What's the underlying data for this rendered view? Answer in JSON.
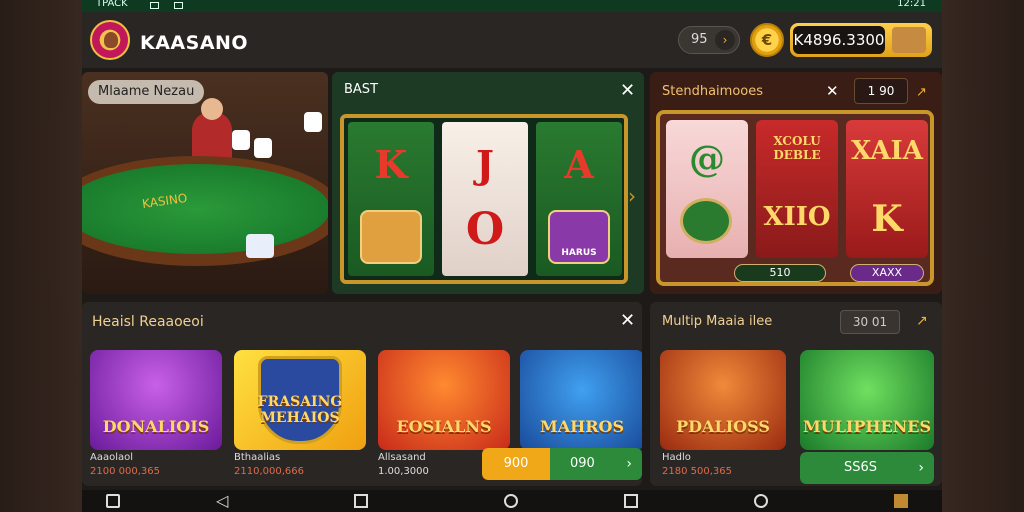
{
  "statusbar": {
    "left": "TPACK",
    "right": "12:21"
  },
  "header": {
    "brand": "KAASANO",
    "pill_value": "95",
    "coin_symbol": "€",
    "balance": "K4896.3300"
  },
  "live_table": {
    "tag": "Mlaame Nezau",
    "felt_text": "KASINO"
  },
  "slots_a": {
    "title": "BAST",
    "reel1_top": "K",
    "reel2_top": "J",
    "reel2_mid": "O",
    "reel3_top": "A",
    "badge_label": "HARUS"
  },
  "slots_b": {
    "title": "Stendhaimooes",
    "mini_value": "1 90",
    "reel1_top": "@",
    "reel2_top": "XCOLU DEBLE",
    "reel2_mid": "XIIO",
    "reel3_top": "XAIA",
    "reel3_mid": "K",
    "bar_left": "510",
    "bar_right": "XAXX"
  },
  "recent": {
    "title": "Heaisl Reaaoeoi",
    "games": [
      {
        "name": "DONALIOIS",
        "meta1": "Aaaolaol",
        "meta2": "2100 000,365"
      },
      {
        "name": "FRASAING MEHAIOS",
        "meta1": "Bthaalias",
        "meta2": "2110,000,666"
      },
      {
        "name": "EOSIALNS",
        "meta1": "Allsasand",
        "meta2": "1.00,3000"
      },
      {
        "name": "MAHROS",
        "meta1": "",
        "meta2": ""
      }
    ],
    "btn_left": "900",
    "btn_right": "090"
  },
  "multi": {
    "title": "Multip Maaia ilee",
    "mini_value": "30 01",
    "games": [
      {
        "name": "PDALIOSS",
        "meta1": "Hadlo",
        "meta2": "2180 500,365"
      },
      {
        "name": "MULIPHENES",
        "meta1": "",
        "meta2": ""
      }
    ],
    "btn_label": "SS6S"
  },
  "colors": {
    "accent": "#f0a818",
    "go": "#2c8a3a",
    "header": "#2a2624"
  }
}
